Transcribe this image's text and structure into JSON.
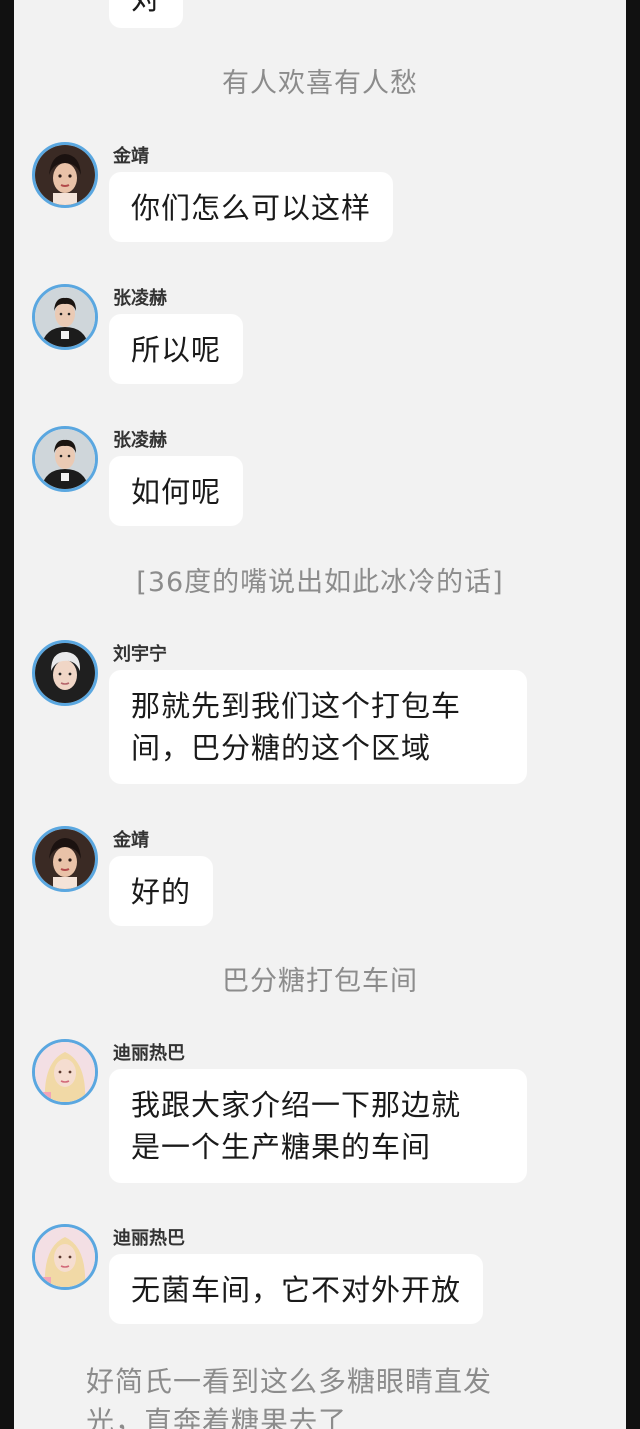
{
  "chat": {
    "top_partial_bubble": "对",
    "narration_1": "有人欢喜有人愁",
    "messages": [
      {
        "name": "金靖",
        "text": "你们怎么可以这样"
      },
      {
        "name": "张凌赫",
        "text": "所以呢"
      },
      {
        "name": "张凌赫",
        "text": "如何呢"
      },
      {
        "name": "刘宇宁",
        "line1": "那就先到我们这个打包车",
        "line2": "间，巴分糖的这个区域"
      },
      {
        "name": "金靖",
        "text": "好的"
      },
      {
        "name": "迪丽热巴",
        "line1": "我跟大家介绍一下那边就",
        "line2": "是一个生产糖果的车间"
      },
      {
        "name": "迪丽热巴",
        "text": "无菌车间，它不对外开放"
      }
    ],
    "narration_2": "[36度的嘴说出如此冰冷的话]",
    "narration_3": "巴分糖打包车间",
    "footer_line1": "好简氏一看到这么多糖眼睛直发",
    "footer_line2": "光，直奔着糖果去了"
  },
  "colors": {
    "background": "#f2f2f2",
    "bubble": "#ffffff",
    "avatar_ring": "#5aa7e0",
    "narration": "#8c8c8c"
  },
  "icons": {
    "avatar_jinjing": "avatar-woman-dark-hair",
    "avatar_zhanglinghe": "avatar-man-dark-jacket",
    "avatar_liuyuning": "avatar-man-white-hair",
    "avatar_dilireba": "avatar-woman-blonde-hair"
  }
}
